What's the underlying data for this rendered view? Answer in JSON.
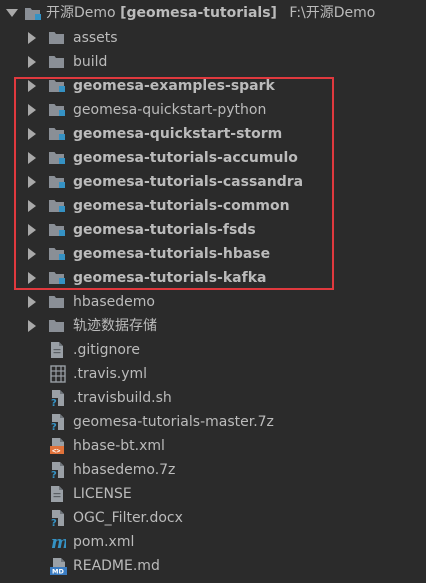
{
  "colors": {
    "background": "#2b2b2b",
    "text": "#bbbbbb",
    "folder": "#8a8f96",
    "module_badge": "#3592c4",
    "highlight_box": "#e0393e"
  },
  "root": {
    "name": "开源Demo",
    "module": "[geomesa-tutorials]",
    "path": "F:\\开源Demo",
    "icon": "module-folder-icon"
  },
  "items": [
    {
      "label": "assets",
      "type": "folder",
      "bold": false
    },
    {
      "label": "build",
      "type": "folder",
      "bold": false
    },
    {
      "label": "geomesa-examples-spark",
      "type": "module",
      "bold": true
    },
    {
      "label": "geomesa-quickstart-python",
      "type": "module",
      "bold": false
    },
    {
      "label": "geomesa-quickstart-storm",
      "type": "module",
      "bold": true
    },
    {
      "label": "geomesa-tutorials-accumulo",
      "type": "module",
      "bold": true
    },
    {
      "label": "geomesa-tutorials-cassandra",
      "type": "module",
      "bold": true
    },
    {
      "label": "geomesa-tutorials-common",
      "type": "module",
      "bold": true
    },
    {
      "label": "geomesa-tutorials-fsds",
      "type": "module",
      "bold": true
    },
    {
      "label": "geomesa-tutorials-hbase",
      "type": "module",
      "bold": true
    },
    {
      "label": "geomesa-tutorials-kafka",
      "type": "module",
      "bold": true
    },
    {
      "label": "hbasedemo",
      "type": "folder",
      "bold": false
    },
    {
      "label": "轨迹数据存储",
      "type": "folder",
      "bold": false
    },
    {
      "label": ".gitignore",
      "type": "text-file",
      "bold": false
    },
    {
      "label": ".travis.yml",
      "type": "yml-file",
      "bold": false
    },
    {
      "label": ".travisbuild.sh",
      "type": "unknown-file",
      "bold": false
    },
    {
      "label": "geomesa-tutorials-master.7z",
      "type": "unknown-file",
      "bold": false
    },
    {
      "label": "hbase-bt.xml",
      "type": "xml-file",
      "bold": false
    },
    {
      "label": "hbasedemo.7z",
      "type": "unknown-file",
      "bold": false
    },
    {
      "label": "LICENSE",
      "type": "text-file",
      "bold": false
    },
    {
      "label": "OGC_Filter.docx",
      "type": "unknown-file",
      "bold": false
    },
    {
      "label": "pom.xml",
      "type": "maven-file",
      "bold": false
    },
    {
      "label": "README.md",
      "type": "markdown-file",
      "bold": false
    }
  ]
}
